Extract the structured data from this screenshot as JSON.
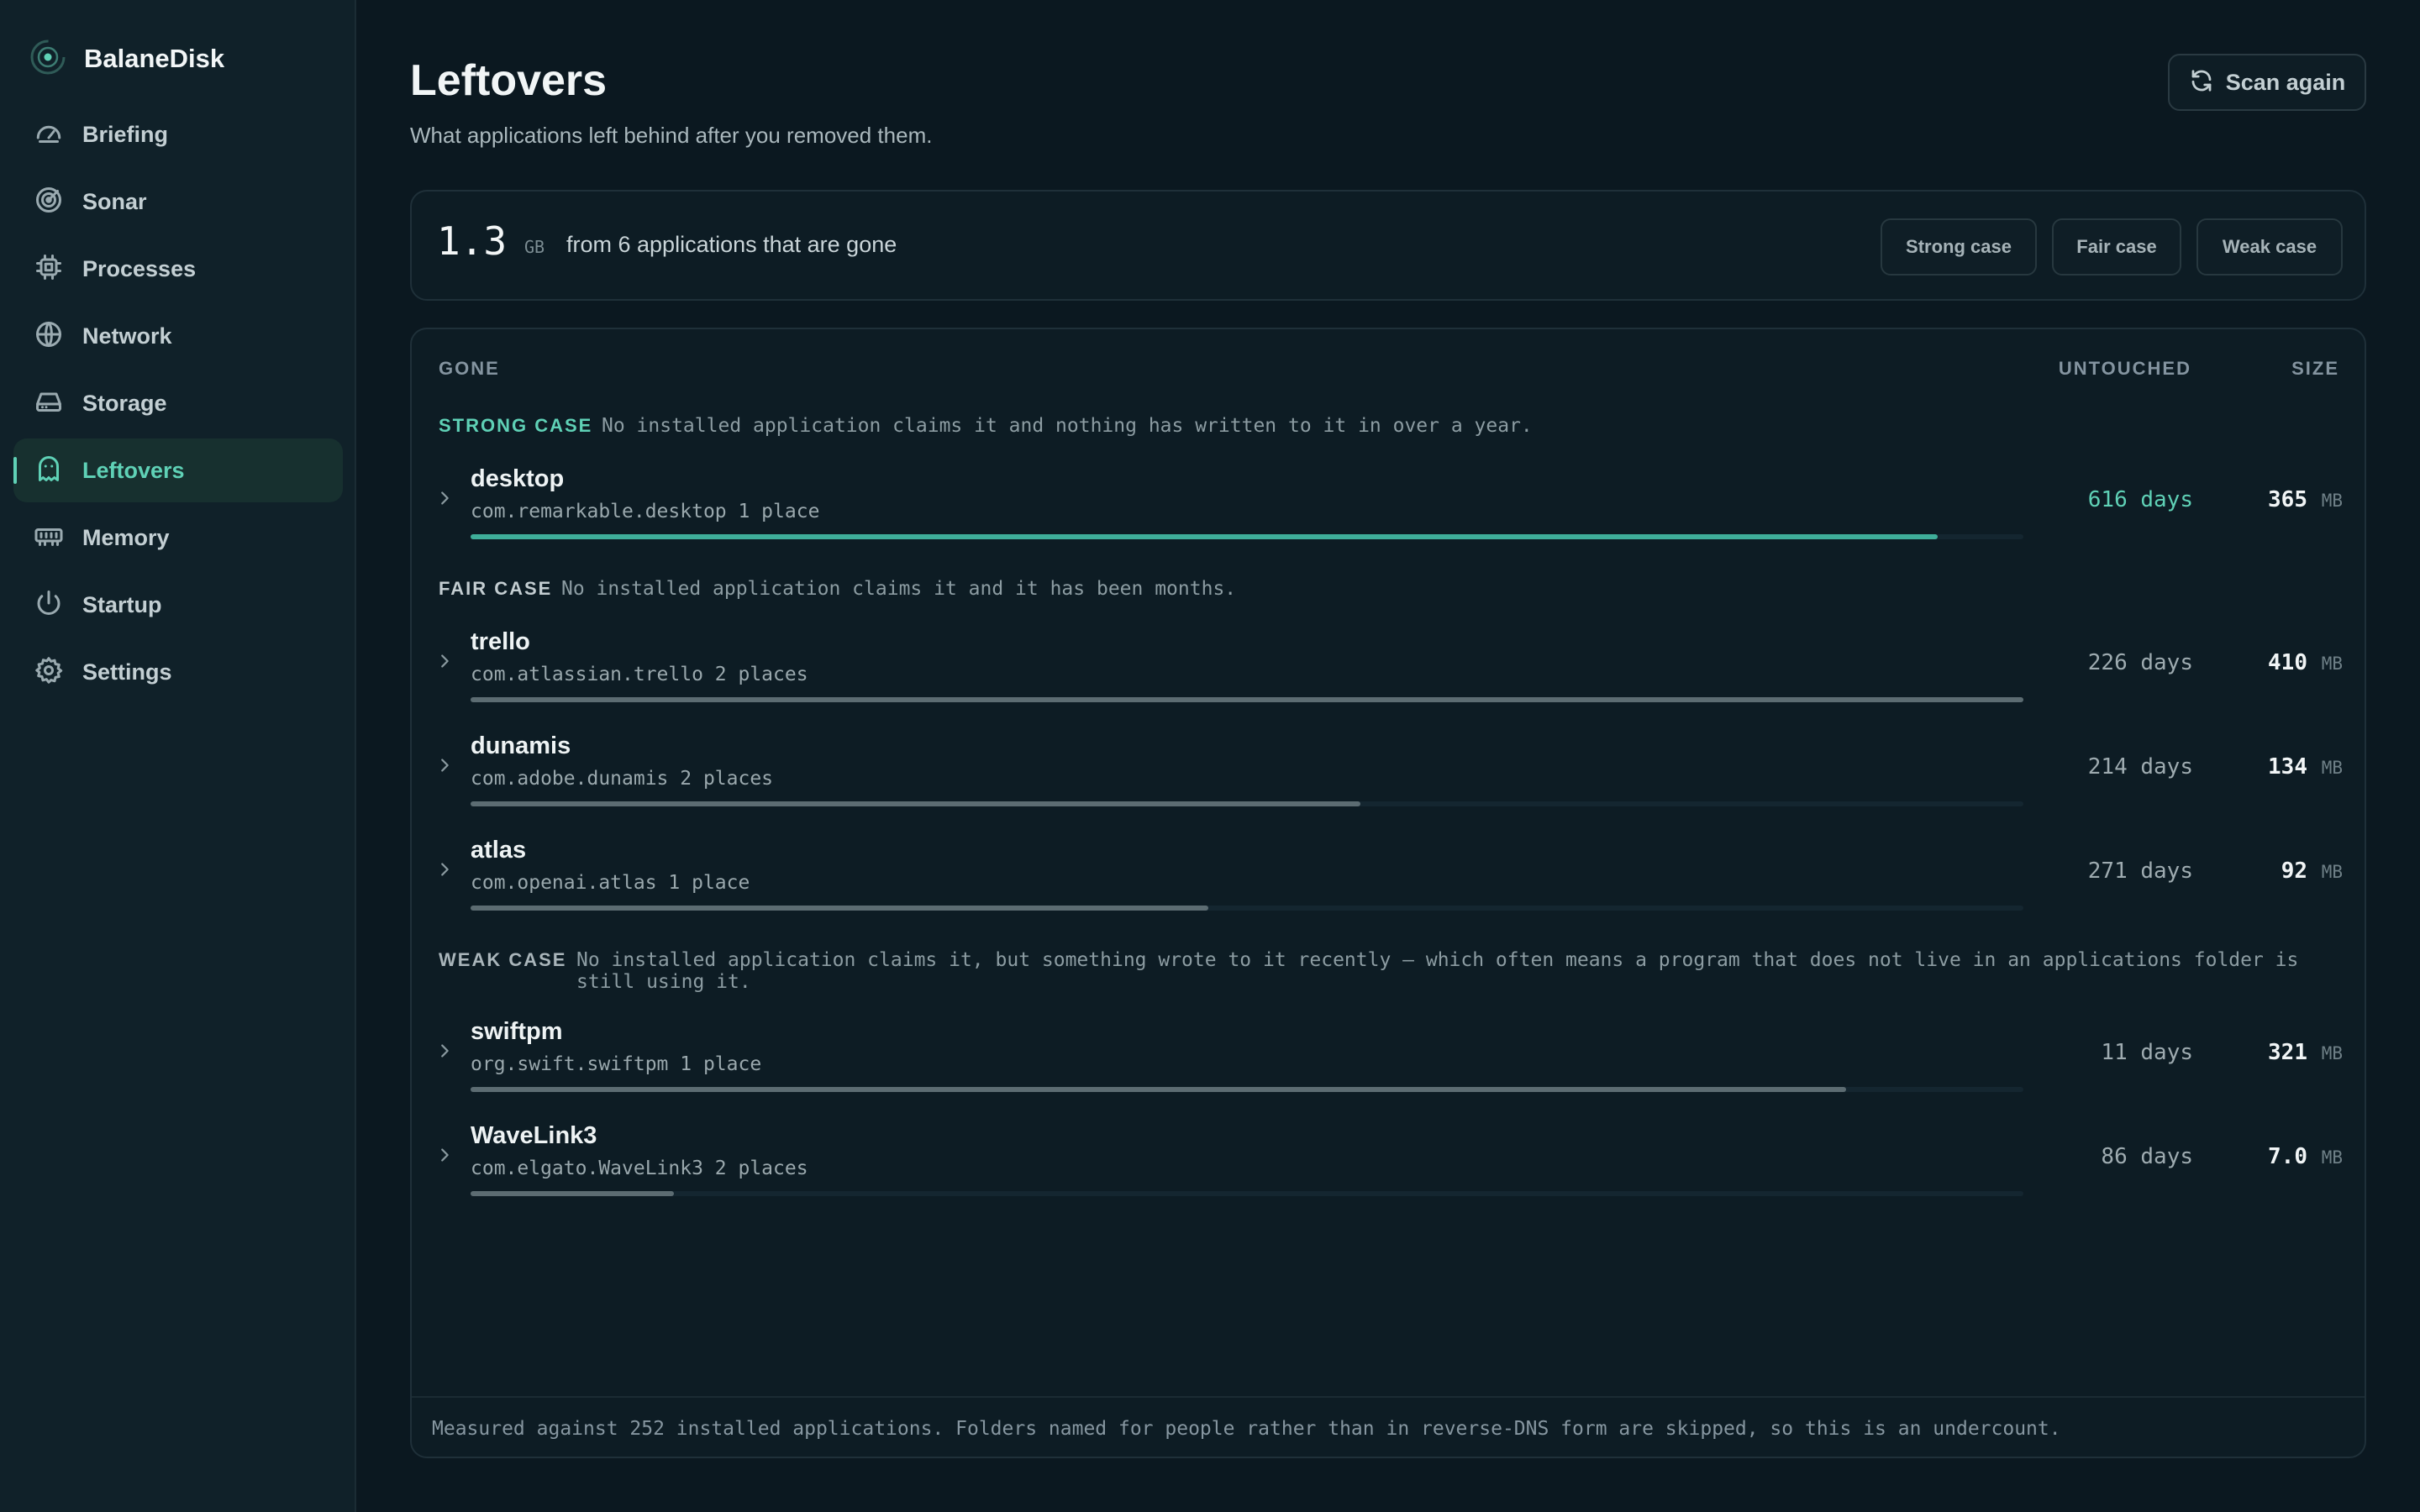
{
  "app": {
    "name": "BalaneDisk"
  },
  "sidebar": {
    "items": [
      {
        "label": "Briefing",
        "icon": "gauge-icon"
      },
      {
        "label": "Sonar",
        "icon": "radar-icon"
      },
      {
        "label": "Processes",
        "icon": "cpu-icon"
      },
      {
        "label": "Network",
        "icon": "globe-icon"
      },
      {
        "label": "Storage",
        "icon": "drive-icon"
      },
      {
        "label": "Leftovers",
        "icon": "ghost-icon",
        "active": true
      },
      {
        "label": "Memory",
        "icon": "memory-icon"
      },
      {
        "label": "Startup",
        "icon": "power-icon"
      },
      {
        "label": "Settings",
        "icon": "gear-icon"
      }
    ]
  },
  "header": {
    "title": "Leftovers",
    "subtitle": "What applications left behind after you removed them.",
    "scan_label": "Scan again"
  },
  "summary": {
    "amount": "1.3",
    "unit": "GB",
    "description": "from 6 applications that are gone",
    "filters": [
      "Strong case",
      "Fair case",
      "Weak case"
    ]
  },
  "table": {
    "columns": {
      "gone": "GONE",
      "untouched": "UNTOUCHED",
      "size": "SIZE"
    },
    "groups": [
      {
        "title": "STRONG CASE",
        "description": "No installed application claims it and nothing has written to it in over a year.",
        "color": "#5fd1b6",
        "rows": [
          {
            "name": "desktop",
            "bundle": "com.remarkable.desktop 1 place",
            "days": "616 days",
            "size": "365",
            "unit": "MB",
            "bar_fraction": 0.945,
            "highlight": true
          }
        ]
      },
      {
        "title": "FAIR CASE",
        "description": "No installed application claims it and it has been months.",
        "color": "#c3cdd1",
        "rows": [
          {
            "name": "trello",
            "bundle": "com.atlassian.trello 2 places",
            "days": "226 days",
            "size": "410",
            "unit": "MB",
            "bar_fraction": 1.0
          },
          {
            "name": "dunamis",
            "bundle": "com.adobe.dunamis 2 places",
            "days": "214 days",
            "size": "134",
            "unit": "MB",
            "bar_fraction": 0.573
          },
          {
            "name": "atlas",
            "bundle": "com.openai.atlas 1 place",
            "days": "271 days",
            "size": "92",
            "unit": "MB",
            "bar_fraction": 0.475
          }
        ]
      },
      {
        "title": "WEAK CASE",
        "description": "No installed application claims it, but something wrote to it recently — which often means a program that does not live in an applications folder is still using it.",
        "color": "#a9b5ba",
        "rows": [
          {
            "name": "swiftpm",
            "bundle": "org.swift.swiftpm 1 place",
            "days": "11 days",
            "size": "321",
            "unit": "MB",
            "bar_fraction": 0.886
          },
          {
            "name": "WaveLink3",
            "bundle": "com.elgato.WaveLink3 2 places",
            "days": "86 days",
            "size": "7.0",
            "unit": "MB",
            "bar_fraction": 0.131
          }
        ]
      }
    ],
    "footnote": "Measured against 252 installed applications. Folders named for people rather than in reverse-DNS form are skipped, so this is an undercount."
  }
}
